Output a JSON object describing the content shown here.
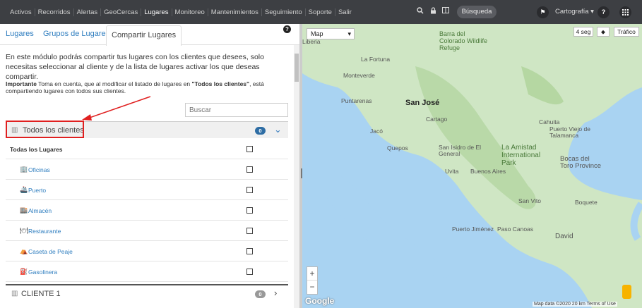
{
  "nav": {
    "items": [
      "Activos",
      "Recorridos",
      "Alertas",
      "GeoCercas",
      "Lugares",
      "Monitoreo",
      "Mantenimientos",
      "Seguimiento",
      "Soporte",
      "Salir"
    ],
    "active": "Lugares",
    "search_label": "Búsqueda",
    "cartography_label": "Cartografía",
    "icons": [
      "search-icon",
      "lock-icon",
      "window-icon",
      "flag-icon",
      "help-icon",
      "grid-icon"
    ]
  },
  "tabs": [
    "Lugares",
    "Grupos de Lugares",
    "Compartir Lugares"
  ],
  "active_tab": "Compartir Lugares",
  "description": "En este módulo podrás compartir tus lugares con los clientes que desees, solo necesitas seleccionar al cliente y de la lista de lugares activar los que deseas compartir.",
  "note": {
    "strong": "Importante",
    "text_before": " Toma en cuenta, que al modificar el listado de lugares en ",
    "highlight": "\"Todos los clientes\"",
    "text_after": ", está compartiendo lugares con todos sus clientes."
  },
  "search_placeholder": "Buscar",
  "groups": [
    {
      "label": "Todos los clientes",
      "count": "0"
    },
    {
      "label": "CLIENTE 1",
      "count": "0"
    }
  ],
  "all_places_label": "Todas los Lugares",
  "places": [
    {
      "label": "Oficinas",
      "icon": "building-icon"
    },
    {
      "label": "Puerto",
      "icon": "ship-icon"
    },
    {
      "label": "Almacén",
      "icon": "warehouse-icon"
    },
    {
      "label": "Restaurante",
      "icon": "restaurant-icon"
    },
    {
      "label": "Caseta de Peaje",
      "icon": "toll-icon"
    },
    {
      "label": "Gasolinera",
      "icon": "gas-station-icon"
    }
  ],
  "map": {
    "type_select": "Map",
    "refresh": "4 seg",
    "traffic": "Tráfico",
    "attribution": "Map data ©2020   20 km        Terms of Use",
    "logo": "Google",
    "labels": [
      "Barra del Colorado Wildlife Refuge",
      "La Fortuna",
      "Monteverde",
      "Puntarenas",
      "San José",
      "Cartago",
      "Jacó",
      "Quepos",
      "San Isidro de El General",
      "La Amistad International Park",
      "Uvita",
      "Buenos Aires",
      "Cahuita",
      "Puerto Viejo de Talamanca",
      "Bocas del Toro Province",
      "San Vito",
      "Puerto Jiménez",
      "Paso Canoas",
      "David",
      "Boquete",
      "Liberia"
    ]
  }
}
